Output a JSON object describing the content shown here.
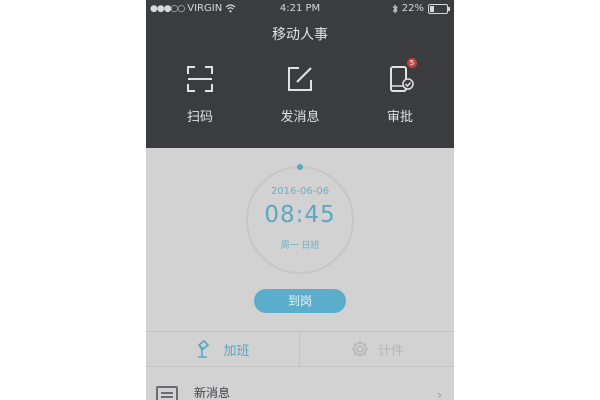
{
  "status_bar": {
    "signal": "●●●○○",
    "carrier": "VIRGIN",
    "time": "4:21 PM",
    "battery": "22%"
  },
  "header": {
    "title": "移动人事"
  },
  "actions": [
    {
      "label": "扫码",
      "icon": "scan-icon"
    },
    {
      "label": "发消息",
      "icon": "compose-icon"
    },
    {
      "label": "审批",
      "icon": "phone-approve-icon",
      "badge": "5"
    }
  ],
  "clock": {
    "date": "2016-06-06",
    "time": "08:45",
    "shift": "周一 日班"
  },
  "checkin_button": "到岗",
  "tabs": [
    {
      "label": "加班",
      "icon": "desk-lamp-icon"
    },
    {
      "label": "计件",
      "icon": "gear-icon"
    }
  ],
  "message_row": {
    "label": "新消息",
    "icon": "message-icon"
  },
  "colors": {
    "accent": "#5aa7c2",
    "header_bg": "#3a3c40",
    "badge": "#c4443e"
  }
}
